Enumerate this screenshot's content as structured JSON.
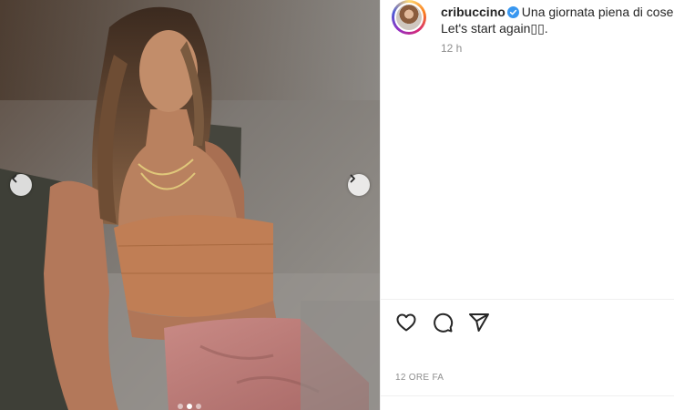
{
  "post": {
    "username": "cribuccino",
    "verified": true,
    "caption_line1": "Una giornata piena di cose a",
    "caption_line2": "Let's start again▯▯.",
    "time_ago": "12 h",
    "posted_label": "12 ORE FA"
  },
  "carousel": {
    "slide_count": 3,
    "active_index": 1
  },
  "icons": {
    "verified": "verified-badge-icon",
    "prev": "chevron-left-icon",
    "next": "chevron-right-icon",
    "like": "heart-icon",
    "comment": "comment-icon",
    "share": "paper-plane-icon"
  },
  "colors": {
    "verified_badge": "#3897f0",
    "text_primary": "#262626",
    "text_secondary": "#8e8e8e"
  }
}
